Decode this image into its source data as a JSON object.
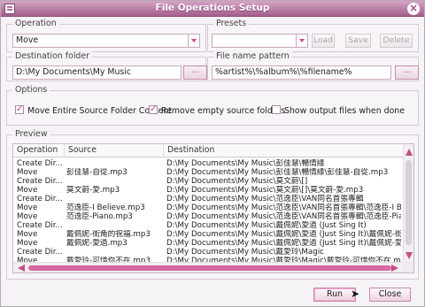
{
  "window": {
    "title": "File Operations Setup",
    "close_icon": "close-icon"
  },
  "operation": {
    "legend": "Operation",
    "selected": "Move"
  },
  "presets": {
    "legend": "Presets",
    "selected": "",
    "load": "Load",
    "save": "Save",
    "delete": "Delete"
  },
  "destination": {
    "legend": "Destination folder",
    "value": "D:\\My Documents\\My Music",
    "browse": "..."
  },
  "pattern": {
    "legend": "File name pattern",
    "value": "%artist%\\%album%\\%filename%",
    "browse": "..."
  },
  "options": {
    "legend": "Options",
    "move_entire": "Move Entire Source Folder Content",
    "remove_empty": "Remove empty source folders",
    "show_output": "Show output files when done"
  },
  "preview": {
    "legend": "Preview",
    "columns": [
      "Operation",
      "Source",
      "Destination"
    ],
    "rows": [
      [
        "Create Dir...",
        "",
        "D:\\My Documents\\My Music\\彭佳慧\\暢情緣"
      ],
      [
        "Move",
        "彭佳慧-自從.mp3",
        "D:\\My Documents\\My Music\\彭佳慧\\暢情緣\\彭佳慧-自從.mp3"
      ],
      [
        "Create Dir...",
        "",
        "D:\\My Documents\\My Music\\莫文蔚\\[]"
      ],
      [
        "Move",
        "莫文蔚-愛.mp3",
        "D:\\My Documents\\My Music\\莫文蔚\\[]\\莫文蔚-愛.mp3"
      ],
      [
        "Create Dir...",
        "",
        "D:\\My Documents\\My Music\\范逸臣\\VAN同名首張專輯"
      ],
      [
        "Move",
        "范逸臣-I Believe.mp3",
        "D:\\My Documents\\My Music\\范逸臣\\VAN同名首張專輯\\范逸臣-I Believ..."
      ],
      [
        "Move",
        "范逸臣-Piano.mp3",
        "D:\\My Documents\\My Music\\范逸臣\\VAN同名首張專輯\\范逸臣-Piano.mp"
      ],
      [
        "Create Dir...",
        "",
        "D:\\My Documents\\My Music\\戴佩妮\\愛過 (Just Sing It)"
      ],
      [
        "Move",
        "戴佩妮-街角的祝福.mp3",
        "D:\\My Documents\\My Music\\戴佩妮\\愛過 (Just Sing It)\\戴佩妮-街角的..."
      ],
      [
        "Move",
        "戴佩妮-愛過.mp3",
        "D:\\My Documents\\My Music\\戴佩妮\\愛過 (Just Sing It)\\戴佩妮-愛過.mp3"
      ],
      [
        "Create Dir...",
        "",
        "D:\\My Documents\\My Music\\戴愛玲\\Magic"
      ],
      [
        "Move",
        "戴愛玲-可惜你不在.mp3",
        "D:\\My Documents\\My Music\\戴愛玲\\Magic\\戴愛玲-可惜你不在.mp3"
      ]
    ]
  },
  "buttons": {
    "run": "Run",
    "close": "Close"
  },
  "icons": {
    "app": "app-icon",
    "dropdown": "chevron-down-icon",
    "browse": "folder-browse-icon",
    "cursor": "mouse-pointer-icon"
  },
  "colors": {
    "accent": "#c24f84",
    "title_bar": "#a55f8e"
  }
}
